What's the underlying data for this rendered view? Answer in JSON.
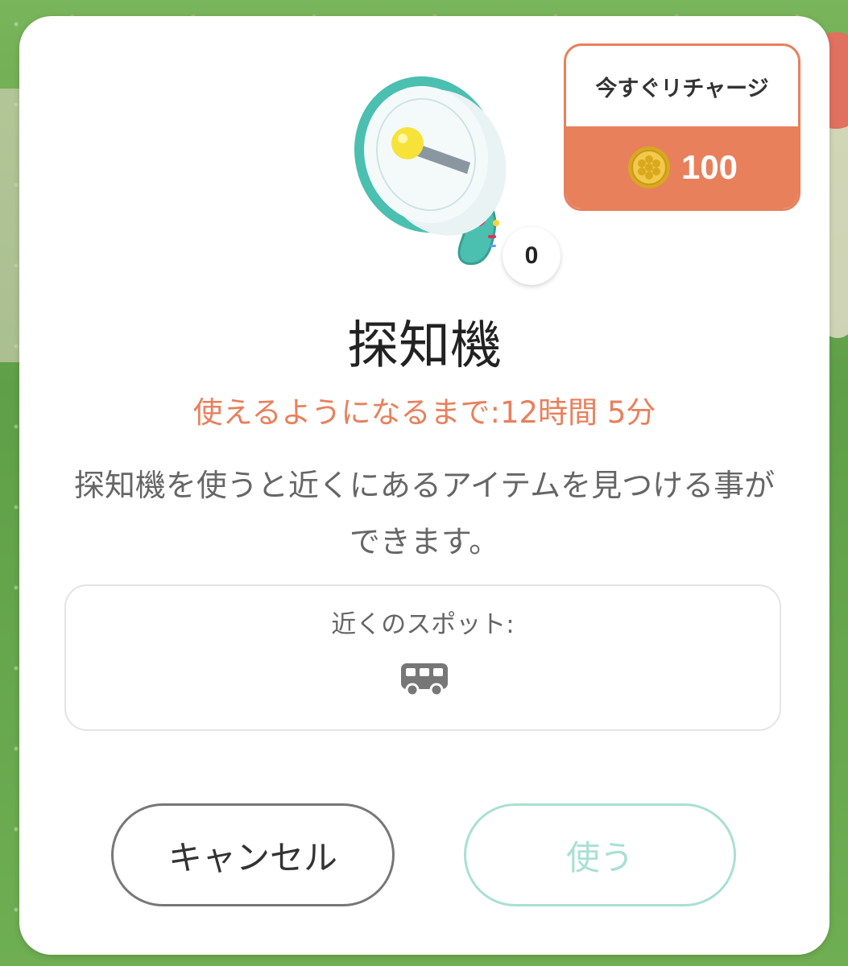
{
  "item": {
    "name": "探知機",
    "count": "0",
    "cooldown": "使えるようになるまで:12時間 5分",
    "description": "探知機を使うと近くにあるアイテムを見つける事ができます。"
  },
  "recharge": {
    "label": "今すぐリチャージ",
    "cost": "100",
    "accent_color": "#e8805c"
  },
  "spots": {
    "label": "近くのスポット:",
    "icons": [
      "bus-icon"
    ]
  },
  "buttons": {
    "cancel": "キャンセル",
    "use": "使う",
    "use_color": "#a9e0d2"
  }
}
